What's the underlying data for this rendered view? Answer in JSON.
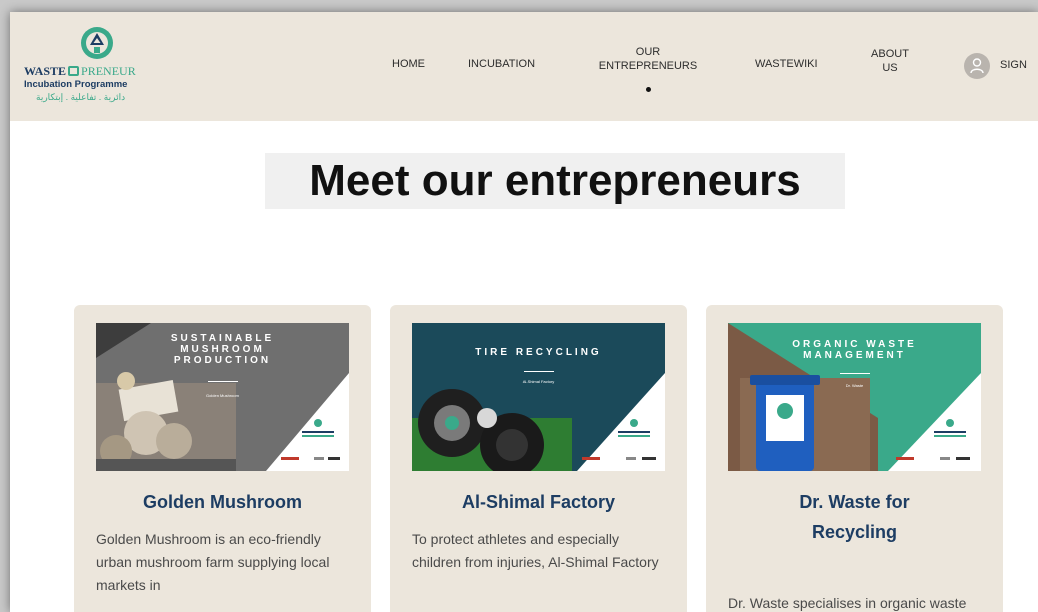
{
  "brand": {
    "title_part1": "WASTE",
    "title_part2": "PRENEUR",
    "subtitle": "Incubation Programme",
    "arabic_tagline": "دائرية . تفاعلية . إبتكارية",
    "colors": {
      "navy": "#1d3d63",
      "green": "#3aa98a",
      "header_bg": "#ece6dc"
    }
  },
  "nav": {
    "items": [
      {
        "label": "HOME"
      },
      {
        "label": "INCUBATION"
      },
      {
        "label": "OUR ENTREPRENEURS",
        "active": true
      },
      {
        "label": "WASTEWIKI"
      },
      {
        "label": "ABOUT US"
      }
    ],
    "sign_in_label": "SIGN"
  },
  "page": {
    "title": "Meet our entrepreneurs"
  },
  "cards": [
    {
      "banner": "SUSTAINABLE MUSHROOM PRODUCTION",
      "banner_sub": "Golden Mushroom",
      "name": "Golden Mushroom",
      "description": "Golden Mushroom is an eco-friendly urban mushroom farm supplying local markets in"
    },
    {
      "banner": "TIRE RECYCLING",
      "banner_sub": "Al-Shimal Factory",
      "name": "Al-Shimal Factory",
      "description": "To protect athletes and especially children from injuries, Al-Shimal Factory"
    },
    {
      "banner": "ORGANIC WASTE MANAGEMENT",
      "banner_sub": "Dr. Waste",
      "name": "Dr. Waste for Recycling",
      "description": "Dr. Waste specialises in organic waste management. It"
    }
  ]
}
